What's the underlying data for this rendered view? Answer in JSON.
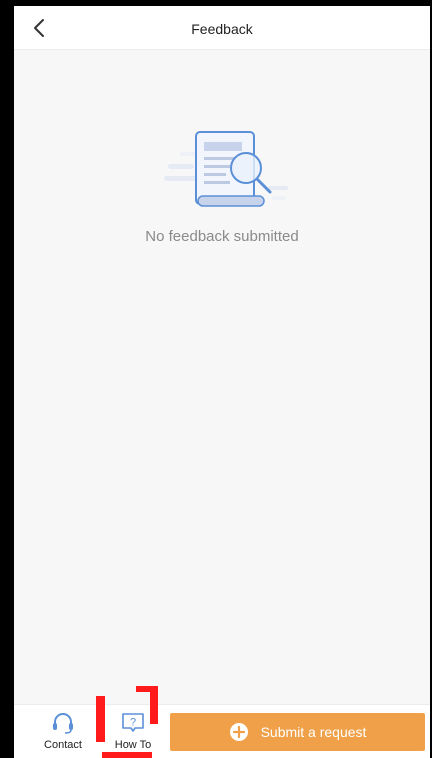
{
  "header": {
    "title": "Feedback"
  },
  "empty_state": {
    "message": "No feedback submitted",
    "illustration_icon": "document-search-icon"
  },
  "bottom_bar": {
    "contact_label": "Contact",
    "contact_icon": "headset-icon",
    "howto_label": "How To",
    "howto_icon": "question-bubble-icon",
    "submit_label": "Submit a request",
    "submit_icon": "plus-circle-icon"
  },
  "colors": {
    "accent": "#f0a048",
    "icon_blue": "#5b8fd8",
    "highlight": "#ff1b1b"
  }
}
